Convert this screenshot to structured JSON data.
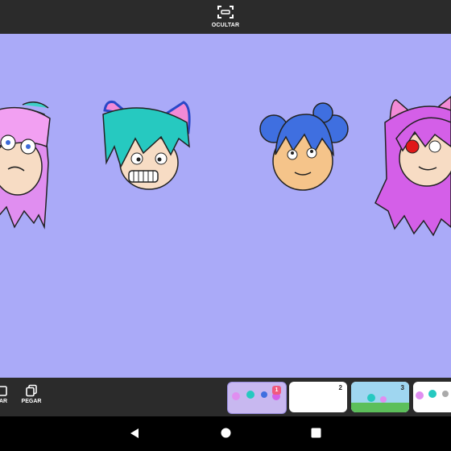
{
  "top_bar": {
    "hide_label": "OCULTAR"
  },
  "bottom_bar": {
    "tools": [
      {
        "label": "AR",
        "icon": "copy-icon"
      },
      {
        "label": "PEGAR",
        "icon": "paste-icon"
      }
    ],
    "frames": [
      {
        "number": "1",
        "selected": true
      },
      {
        "number": "2",
        "selected": false
      },
      {
        "number": "3",
        "selected": false
      }
    ]
  },
  "nav": {
    "back": "back-icon",
    "home": "home-icon",
    "recents": "recents-icon"
  },
  "colors": {
    "canvas": "#aaaaf8",
    "bar": "#2b2b2b",
    "accent": "#f05a7e"
  }
}
